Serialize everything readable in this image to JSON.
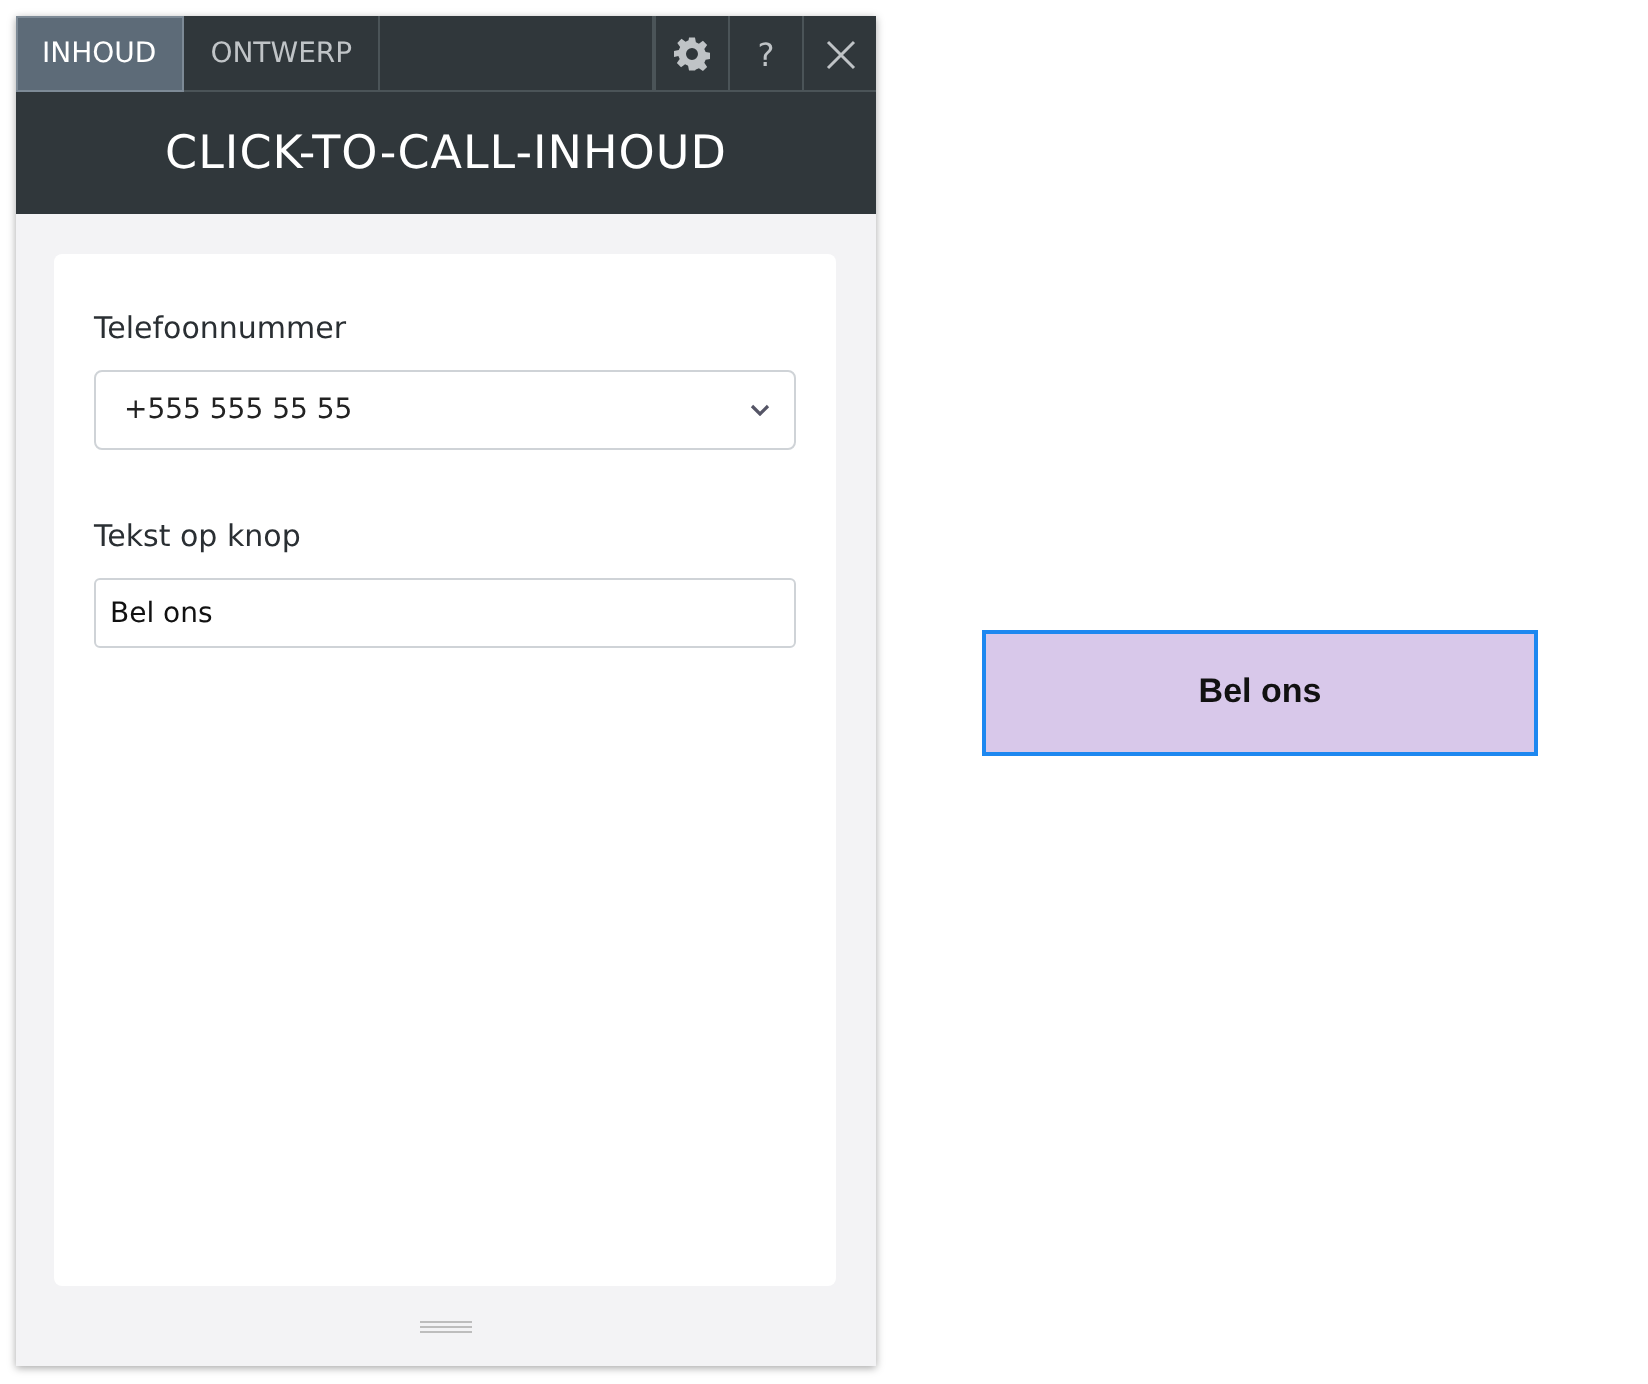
{
  "tabs": [
    {
      "label": "INHOUD",
      "selected": true
    },
    {
      "label": "ONTWERP",
      "selected": false
    }
  ],
  "help_label": "?",
  "title": "CLICK-TO-CALL-INHOUD",
  "fields": [
    {
      "kind": "select",
      "label": "Telefoonnummer",
      "value": "+555 555 55 55"
    },
    {
      "kind": "text",
      "label": "Tekst op knop",
      "value": "Bel ons"
    }
  ],
  "preview_button": {
    "label": "Bel ons"
  }
}
